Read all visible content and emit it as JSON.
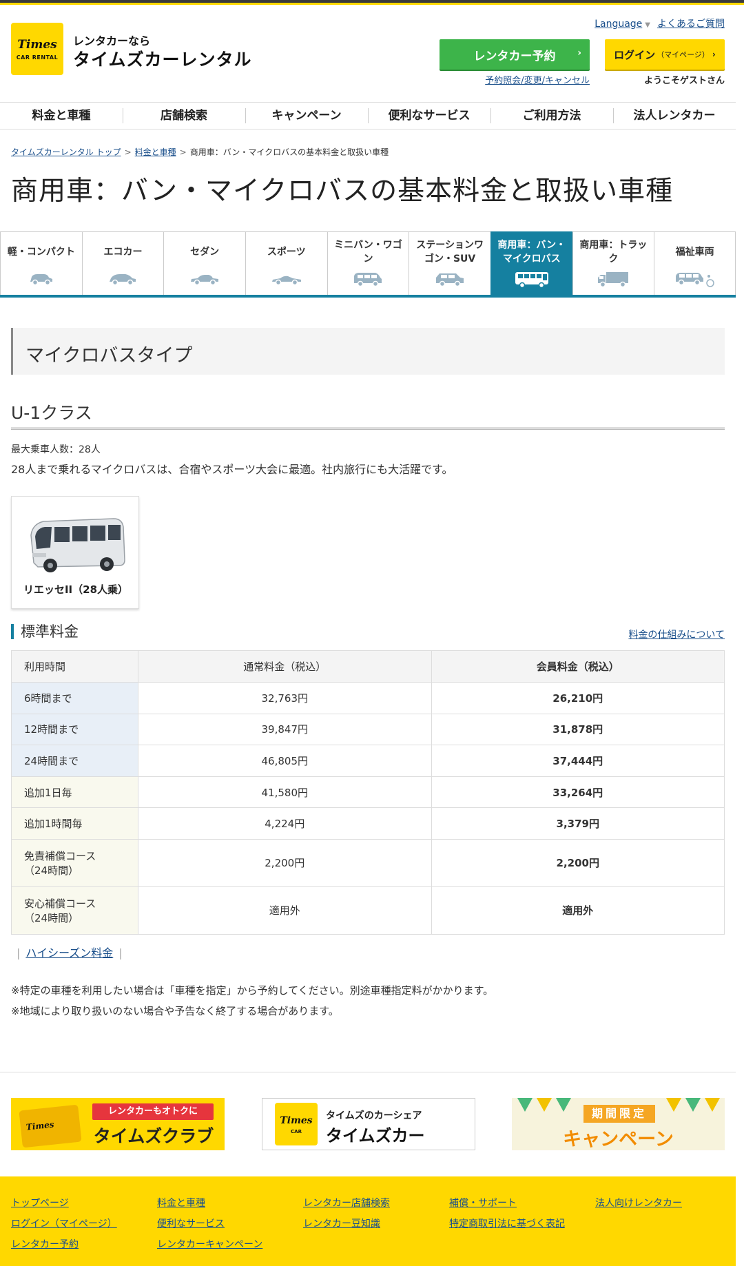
{
  "header": {
    "logo_text": "Times",
    "logo_sub_text": "CAR RENTAL",
    "tagline": "レンタカーなら",
    "brand_name": "タイムズカーレンタル",
    "language_label": "Language",
    "faq_label": "よくあるご質問",
    "reserve_button": "レンタカー予約",
    "reserve_sub_link": "予約照会/変更/キャンセル",
    "login_button": "ログイン",
    "login_button_sub": "（マイページ）",
    "welcome_text": "ようこそゲストさん"
  },
  "gnav": [
    "料金と車種",
    "店舗検索",
    "キャンペーン",
    "便利なサービス",
    "ご利用方法",
    "法人レンタカー"
  ],
  "breadcrumb": {
    "home": "タイムズカーレンタル トップ",
    "sep1": ">",
    "level2": "料金と車種",
    "sep2": ">",
    "current": "商用車：バン・マイクロバスの基本料金と取扱い車種"
  },
  "page_title": "商用車：バン・マイクロバスの基本料金と取扱い車種",
  "category_tabs": [
    {
      "label": "軽・コンパクト",
      "icon": "compact-car-icon"
    },
    {
      "label": "エコカー",
      "icon": "eco-car-icon"
    },
    {
      "label": "セダン",
      "icon": "sedan-icon"
    },
    {
      "label": "スポーツ",
      "icon": "sports-car-icon"
    },
    {
      "label": "ミニバン・ワゴン",
      "icon": "minivan-icon"
    },
    {
      "label": "ステーションワゴン・SUV",
      "icon": "suv-icon"
    },
    {
      "label": "商用車：バン・マイクロバス",
      "icon": "microbus-icon",
      "active": true
    },
    {
      "label": "商用車：トラック",
      "icon": "truck-icon"
    },
    {
      "label": "福祉車両",
      "icon": "welfare-vehicle-icon"
    }
  ],
  "section": {
    "title": "マイクロバスタイプ",
    "class_name": "U-1クラス",
    "capacity": "最大乗車人数：28人",
    "description": "28人まで乗れるマイクロバスは、合宿やスポーツ大会に最適。社内旅行にも大活躍です。",
    "car_name": "リエッセII（28人乗）"
  },
  "rates": {
    "title": "標準料金",
    "link": "料金の仕組みについて",
    "headers": {
      "time": "利用時間",
      "normal": "通常料金（税込）",
      "member": "会員料金（税込）"
    },
    "rows": [
      {
        "time": "6時間まで",
        "normal": "32,763円",
        "member": "26,210円"
      },
      {
        "time": "12時間まで",
        "normal": "39,847円",
        "member": "31,878円"
      },
      {
        "time": "24時間まで",
        "normal": "46,805円",
        "member": "37,444円"
      },
      {
        "time": "追加1日毎",
        "normal": "41,580円",
        "member": "33,264円"
      },
      {
        "time": "追加1時間毎",
        "normal": "4,224円",
        "member": "3,379円"
      },
      {
        "time_l1": "免責補償コース",
        "time_l2": "（24時間）",
        "normal": "2,200円",
        "member": "2,200円"
      },
      {
        "time_l1": "安心補償コース",
        "time_l2": "（24時間）",
        "normal": "適用外",
        "member": "適用外"
      }
    ]
  },
  "high_season_link": "ハイシーズン料金",
  "notes": [
    "※特定の車種を利用したい場合は「車種を指定」から予約してください。別途車種指定料がかかります。",
    "※地域により取り扱いのない場合や予告なく終了する場合があります。"
  ],
  "banners": {
    "club_card_text": "Times",
    "club_pill": "レンタカーもオトクに",
    "club_main": "タイムズクラブ",
    "share_logo": "Times",
    "share_logo_sub": "CAR",
    "share_sub": "タイムズのカーシェア",
    "share_main": "タイムズカー",
    "campaign_tag": "期間限定",
    "campaign_main": "キャンペーン"
  },
  "footer": {
    "col1": [
      "トップページ",
      "ログイン（マイページ）",
      "レンタカー予約"
    ],
    "col2": [
      "料金と車種",
      "便利なサービス",
      "レンタカーキャンペーン"
    ],
    "col3": [
      "レンタカー店舗検索",
      "レンタカー豆知識"
    ],
    "col4": [
      "補償・サポート",
      "特定商取引法に基づく表記"
    ],
    "col5": [
      "法人向けレンタカー"
    ]
  },
  "colors": {
    "brand_yellow": "#ffd800",
    "reserve_green": "#3db44a",
    "active_tab": "#1580a0",
    "link": "#1a4f8b"
  }
}
